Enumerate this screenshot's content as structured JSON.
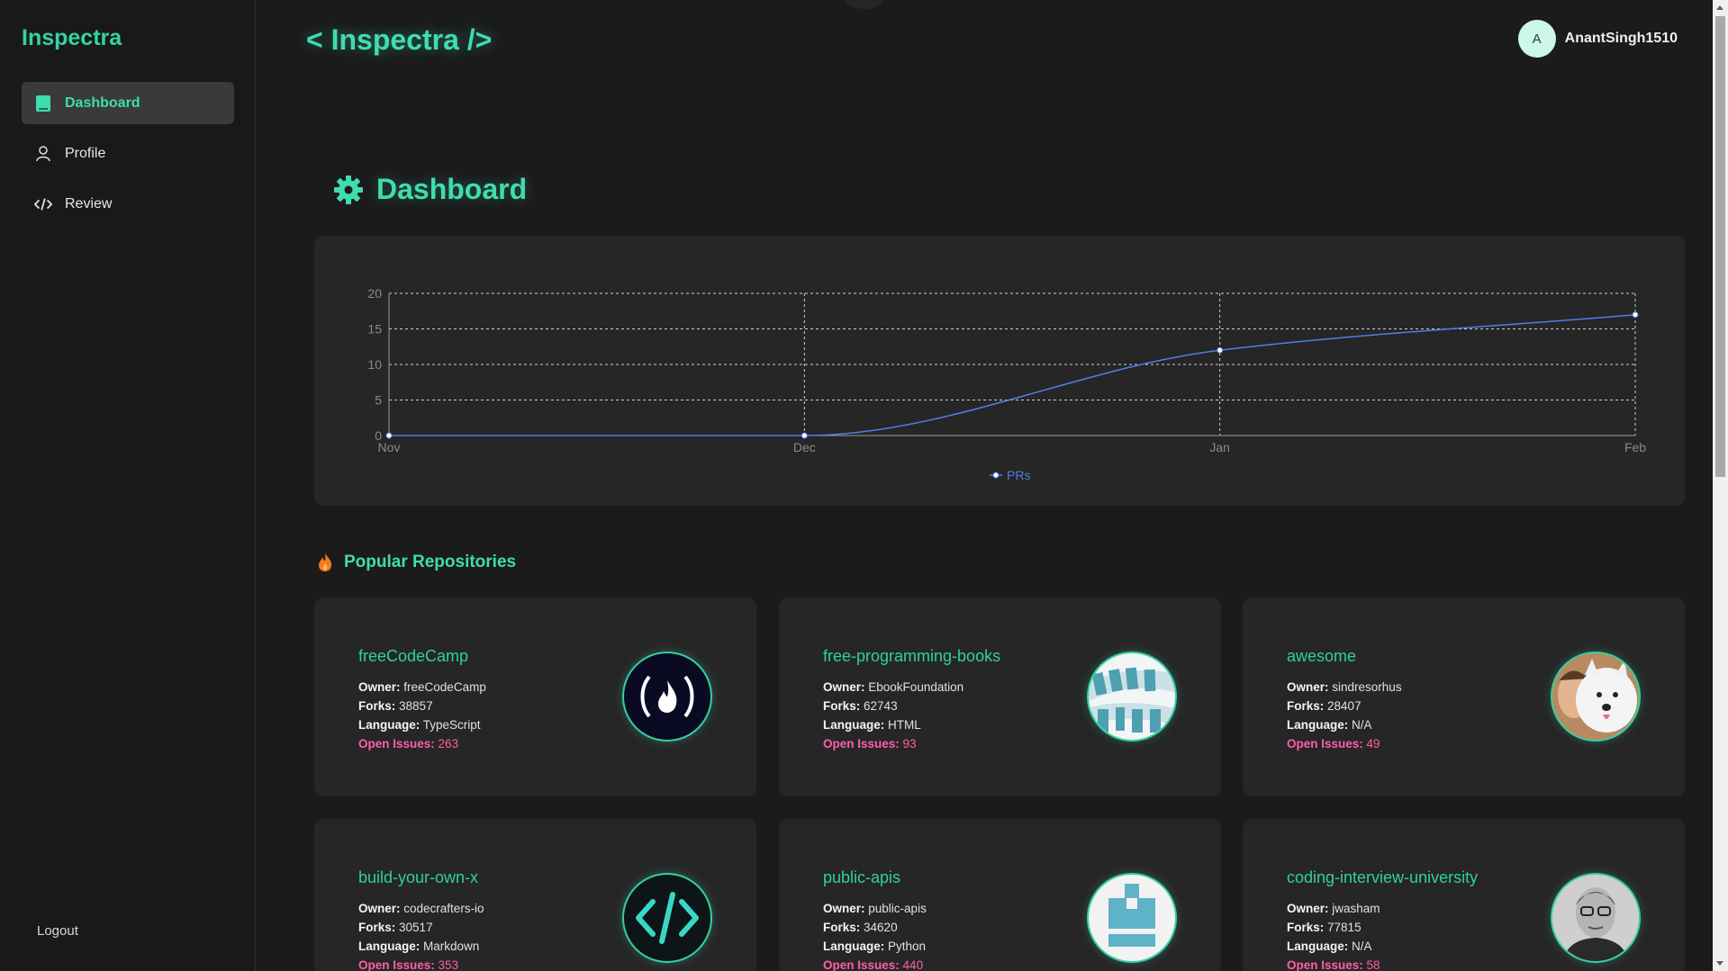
{
  "sidebar": {
    "brand": "Inspectra",
    "items": [
      {
        "label": "Dashboard",
        "icon": "dashboard-icon",
        "active": true
      },
      {
        "label": "Profile",
        "icon": "user-icon",
        "active": false
      },
      {
        "label": "Review",
        "icon": "code-icon",
        "active": false
      }
    ],
    "logout": "Logout"
  },
  "header": {
    "title": "< Inspectra />",
    "user": {
      "initial": "A",
      "name": "AnantSingh1510"
    }
  },
  "main": {
    "heading": "Dashboard",
    "popular_heading": "Popular Repositories",
    "field_labels": {
      "owner": "Owner:",
      "forks": "Forks:",
      "language": "Language:",
      "issues": "Open Issues:"
    },
    "repos": [
      {
        "name": "freeCodeCamp",
        "owner": "freeCodeCamp",
        "forks": "38857",
        "language": "TypeScript",
        "issues": "263",
        "avatar_icon": "campfire-icon"
      },
      {
        "name": "free-programming-books",
        "owner": "EbookFoundation",
        "forks": "62743",
        "language": "HTML",
        "issues": "93",
        "avatar_icon": "ebook-foundation-logo"
      },
      {
        "name": "awesome",
        "owner": "sindresorhus",
        "forks": "28407",
        "language": "N/A",
        "issues": "49",
        "avatar_icon": "person-with-dog-photo"
      },
      {
        "name": "build-your-own-x",
        "owner": "codecrafters-io",
        "forks": "30517",
        "language": "Markdown",
        "issues": "353",
        "avatar_icon": "code-brackets-icon"
      },
      {
        "name": "public-apis",
        "owner": "public-apis",
        "forks": "34620",
        "language": "Python",
        "issues": "440",
        "avatar_icon": "box-stack-icon"
      },
      {
        "name": "coding-interview-university",
        "owner": "jwasham",
        "forks": "77815",
        "language": "N/A",
        "issues": "58",
        "avatar_icon": "person-portrait-photo"
      }
    ]
  },
  "colors": {
    "accent": "#3fdcb0",
    "issues": "#ff5fa8",
    "line": "#4f7fe8",
    "background": "#1b1b1b",
    "card": "#262626"
  },
  "chart_data": {
    "type": "line",
    "categories": [
      "Nov",
      "Dec",
      "Jan",
      "Feb"
    ],
    "series": [
      {
        "name": "PRs",
        "values": [
          0,
          0,
          12,
          17
        ]
      }
    ],
    "yticks": [
      "0",
      "5",
      "10",
      "15",
      "20"
    ],
    "ylim": [
      0,
      20
    ],
    "grid": true,
    "legend": "bottom-center"
  }
}
